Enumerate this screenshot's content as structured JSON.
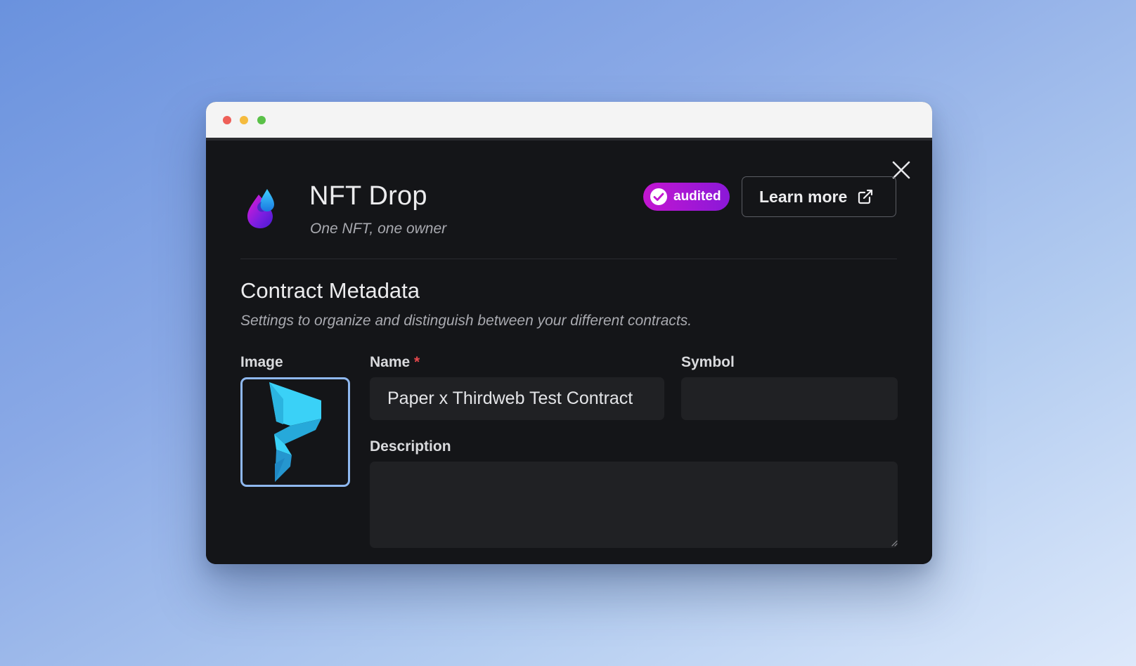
{
  "header": {
    "title": "NFT Drop",
    "badge_label": "audited",
    "subtitle": "One NFT, one owner",
    "learn_more_label": "Learn more"
  },
  "section": {
    "title": "Contract Metadata",
    "description": "Settings to organize and distinguish between your different contracts."
  },
  "form": {
    "image_label": "Image",
    "name_label": "Name",
    "name_required_marker": "*",
    "name_value": "Paper x Thirdweb Test Contract",
    "symbol_label": "Symbol",
    "symbol_value": "",
    "description_label": "Description",
    "description_value": ""
  },
  "colors": {
    "page_background_start": "#6a92de",
    "page_background_end": "#dde9fb",
    "modal_background": "#141518",
    "input_background": "#202124",
    "badge_gradient_start": "#c316d1",
    "badge_gradient_end": "#8a18d8",
    "image_border": "#8fb8ef",
    "required_marker": "#e5484d",
    "paper_logo": "#3ad1f7"
  },
  "icons": {
    "close": "close-icon",
    "logo": "nft-drop-logo-icon",
    "badge": "check-circle-icon",
    "learn_more": "external-link-icon"
  }
}
